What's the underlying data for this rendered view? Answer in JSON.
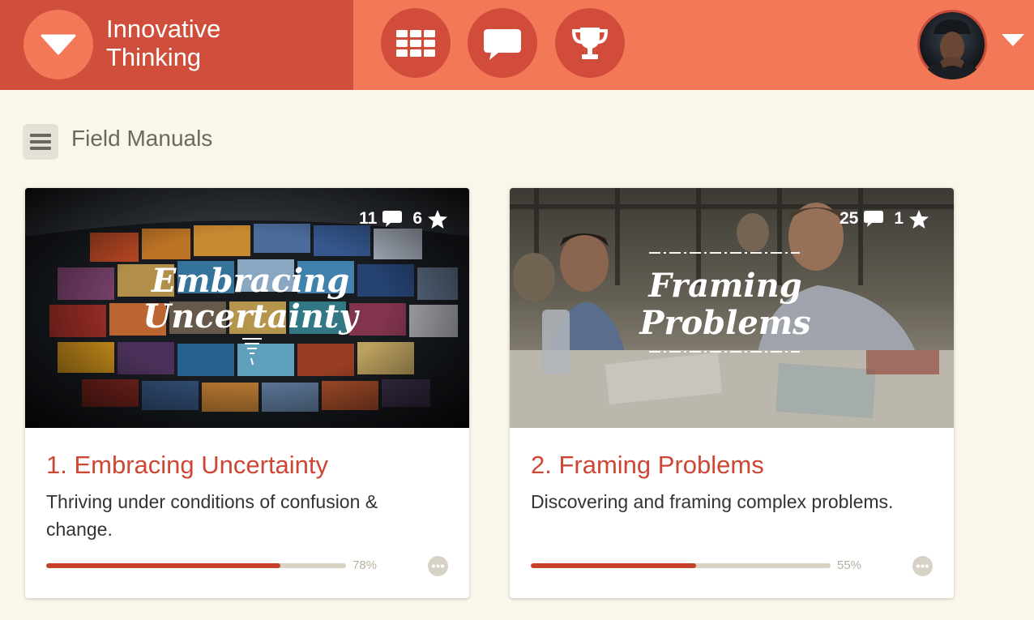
{
  "header": {
    "brand": [
      "Innovative",
      "Thinking"
    ],
    "nav": [
      {
        "name": "grid-icon"
      },
      {
        "name": "chat-bubble-icon"
      },
      {
        "name": "trophy-icon"
      }
    ],
    "user_menu_icon": "chevron-down-icon",
    "colors": {
      "bar": "#f37858",
      "brand_bg": "#cf4f3c",
      "button": "#d24c3b"
    }
  },
  "section": {
    "title": "Field Manuals",
    "menu_icon": "hamburger-icon"
  },
  "cards": [
    {
      "image_title": [
        "Embracing",
        "Uncertainty"
      ],
      "comments": "11",
      "stars": "6",
      "title": "1. Embracing Uncertainty",
      "description": "Thriving under conditions of confusion & change.",
      "progress": 78,
      "progress_label": "78%"
    },
    {
      "image_title": [
        "Framing",
        "Problems"
      ],
      "comments": "25",
      "stars": "1",
      "title": "2. Framing Problems",
      "description": "Discovering and framing complex problems.",
      "progress": 55,
      "progress_label": "55%"
    }
  ],
  "accent_color": "#cd4734",
  "progress_color": "#c8402c"
}
